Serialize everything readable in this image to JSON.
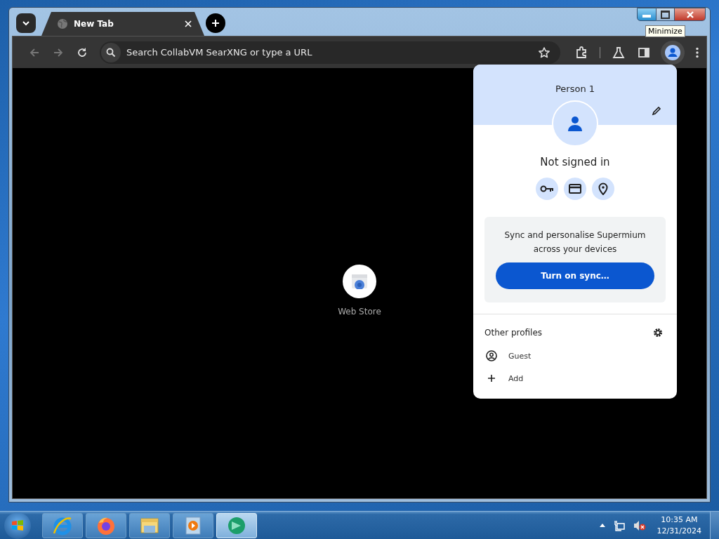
{
  "tab_strip": {
    "tabs": [
      {
        "title": "New Tab",
        "selected": true
      }
    ],
    "tooltip": "Minimize"
  },
  "address_bar": {
    "placeholder": "Search CollabVM SearXNG or type a URL"
  },
  "shortcuts": [
    {
      "label": "Web Store"
    }
  ],
  "profile_menu": {
    "name": "Person 1",
    "status": "Not signed in",
    "sync_text": "Sync and personalise Supermium across your devices",
    "sync_button": "Turn on sync…",
    "other_profiles_title": "Other profiles",
    "profiles": [
      {
        "kind": "guest",
        "label": "Guest"
      },
      {
        "kind": "add",
        "label": "Add"
      }
    ]
  },
  "taskbar": {
    "apps": [
      {
        "kind": "ie",
        "selected": false
      },
      {
        "kind": "firefox",
        "selected": false
      },
      {
        "kind": "explorer",
        "selected": false
      },
      {
        "kind": "media",
        "selected": false
      },
      {
        "kind": "browser",
        "selected": true
      }
    ],
    "time": "10:35 AM",
    "date": "12/31/2024"
  }
}
